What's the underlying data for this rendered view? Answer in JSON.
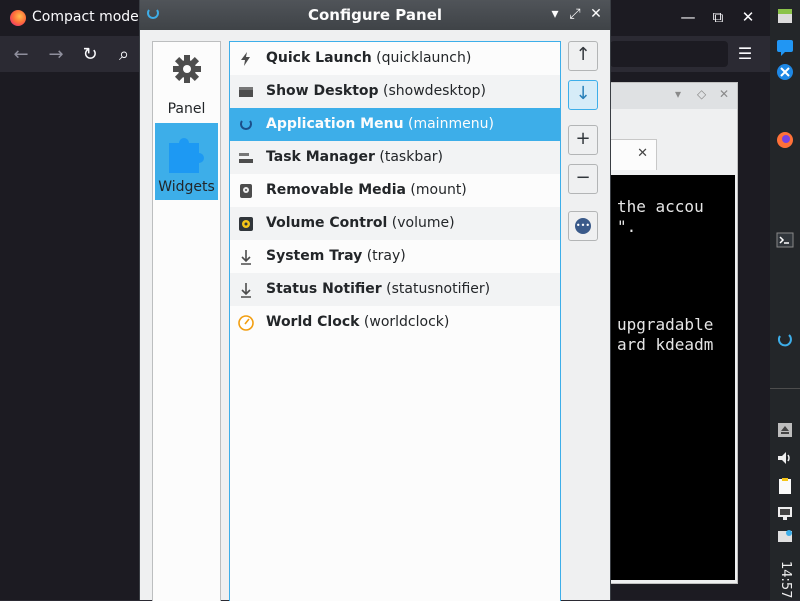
{
  "browser": {
    "tab_title": "Compact mode",
    "minimize": "—",
    "maximize": "⧉",
    "close": "✕",
    "back": "←",
    "forward": "→",
    "reload": "↻",
    "search": "⌕",
    "menu": "☰"
  },
  "terminal": {
    "tab_close": "✕",
    "lines": [
      "the accou",
      "\".",
      "upgradable",
      "ard kdeadm"
    ]
  },
  "dialog": {
    "title": "Configure Panel",
    "controls": {
      "minimize": "▾",
      "maximize": "⤢",
      "close": "✕"
    },
    "categories": [
      {
        "label": "Panel",
        "icon": "gear-icon"
      },
      {
        "label": "Widgets",
        "icon": "puzzle-icon"
      }
    ],
    "widgets": [
      {
        "name": "Quick Launch",
        "id": "(quicklaunch)",
        "icon": "lightning-icon"
      },
      {
        "name": "Show Desktop",
        "id": "(showdesktop)",
        "icon": "desktop-icon"
      },
      {
        "name": "Application Menu",
        "id": "(mainmenu)",
        "icon": "app-menu-icon"
      },
      {
        "name": "Task Manager",
        "id": "(taskbar)",
        "icon": "taskbar-icon"
      },
      {
        "name": "Removable Media",
        "id": "(mount)",
        "icon": "drive-icon"
      },
      {
        "name": "Volume Control",
        "id": "(volume)",
        "icon": "speaker-icon"
      },
      {
        "name": "System Tray",
        "id": "(tray)",
        "icon": "tray-icon"
      },
      {
        "name": "Status Notifier",
        "id": "(statusnotifier)",
        "icon": "notifier-icon"
      },
      {
        "name": "World Clock",
        "id": "(worldclock)",
        "icon": "clock-icon"
      }
    ],
    "selected_index": 2,
    "buttons": {
      "move_up": "↑",
      "move_down": "↓",
      "add": "+",
      "remove": "−",
      "configure": "•••"
    }
  },
  "taskbar": {
    "clock": "14:57"
  },
  "colors": {
    "accent": "#3daee9",
    "titlebar": "#474b50",
    "terminal_bg": "#000000"
  }
}
